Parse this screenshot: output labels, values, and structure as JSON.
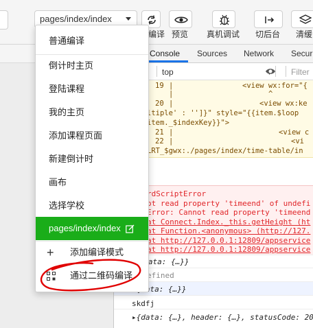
{
  "toolbar": {
    "compile_mode_value": "pages/index/index",
    "buttons": [
      {
        "label": "编译",
        "icon": "refresh-icon"
      },
      {
        "label": "预览",
        "icon": "eye-icon"
      },
      {
        "label": "真机调试",
        "icon": "bug-icon"
      },
      {
        "label": "切后台",
        "icon": "arrow-right-icon"
      },
      {
        "label": "清缓",
        "icon": "layers-icon"
      }
    ]
  },
  "compile_menu": {
    "items": [
      "普通编译",
      "倒计时主页",
      "登陆课程",
      "我的主页",
      "添加课程页面",
      "新建倒计时",
      "画布",
      "选择学校",
      "pages/index/index"
    ],
    "add_mode_label": "添加编译模式",
    "qr_compile_label": "通过二维码编译",
    "selected_color": "#1aad19"
  },
  "devtools": {
    "tabs": [
      "Console",
      "Sources",
      "Network",
      "Secur"
    ],
    "active_tab": "Console",
    "context": "top",
    "filter_placeholder": "Filter",
    "code_lines": [
      {
        "num": "19",
        "text": "<view wx:for=\"{"
      },
      {
        "num": "",
        "text": "^"
      },
      {
        "num": "20",
        "text": "<view wx:ke"
      },
      {
        "num": "",
        "text": "ltiple' : '']}\" style=\"{{item.$loop"
      },
      {
        "num": "",
        "text": "item._$indexKey}}\">"
      },
      {
        "num": "21",
        "text": "<view c"
      },
      {
        "num": "22",
        "text": "<vi"
      },
      {
        "num": "",
        "text": "LRT_$gwx:./pages/index/time-table/in"
      }
    ],
    "errors": [
      "rdScriptError",
      "ot read property 'timeend' of undefi",
      "Error: Cannot read property 'timeend",
      "at Connect.Index._this.getHeight (ht",
      "at Function.<anonymous> (http://127.",
      "at http://127.0.0.1:12809/appservice",
      "at http://127.0.0.1:12809/appservice"
    ],
    "logs": [
      "▸{data: {…}}",
      "efined",
      "▸{data: {…}}",
      "skdfj",
      "▸{data: {…}, header: {…}, statusCode: 20"
    ]
  },
  "annotation_color": "#e00000"
}
